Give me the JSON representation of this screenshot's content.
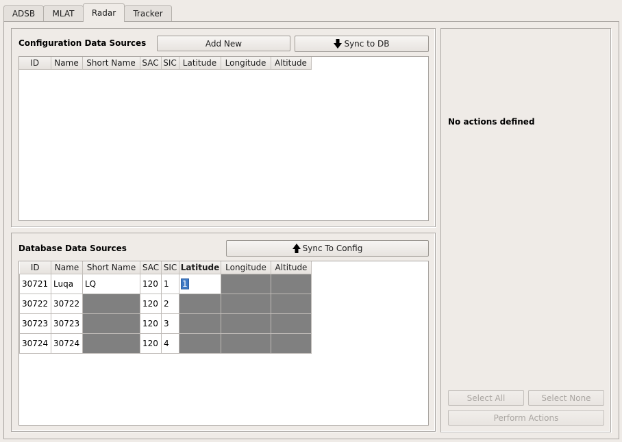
{
  "tabs": [
    {
      "label": "ADSB"
    },
    {
      "label": "MLAT"
    },
    {
      "label": "Radar"
    },
    {
      "label": "Tracker"
    }
  ],
  "config": {
    "title": "Configuration Data Sources",
    "add_new_label": "Add New",
    "sync_to_db_label": "Sync to DB",
    "columns": [
      "ID",
      "Name",
      "Short Name",
      "SAC",
      "SIC",
      "Latitude",
      "Longitude",
      "Altitude"
    ]
  },
  "database": {
    "title": "Database Data Sources",
    "sync_to_config_label": "Sync To Config",
    "columns": [
      "ID",
      "Name",
      "Short Name",
      "SAC",
      "SIC",
      "Latitude",
      "Longitude",
      "Altitude"
    ],
    "rows": [
      [
        "30721",
        "Luqa",
        "LQ",
        "120",
        "1",
        "1",
        "",
        ""
      ],
      [
        "30722",
        "30722",
        "",
        "120",
        "2",
        "",
        "",
        ""
      ],
      [
        "30723",
        "30723",
        "",
        "120",
        "3",
        "",
        "",
        ""
      ],
      [
        "30724",
        "30724",
        "",
        "120",
        "4",
        "",
        "",
        ""
      ]
    ]
  },
  "actions": {
    "message": "No actions defined",
    "select_all_label": "Select All",
    "select_none_label": "Select None",
    "perform_label": "Perform Actions"
  },
  "icons": {
    "sync_to_db": "arrow-down-icon",
    "sync_to_config": "arrow-up-icon"
  }
}
